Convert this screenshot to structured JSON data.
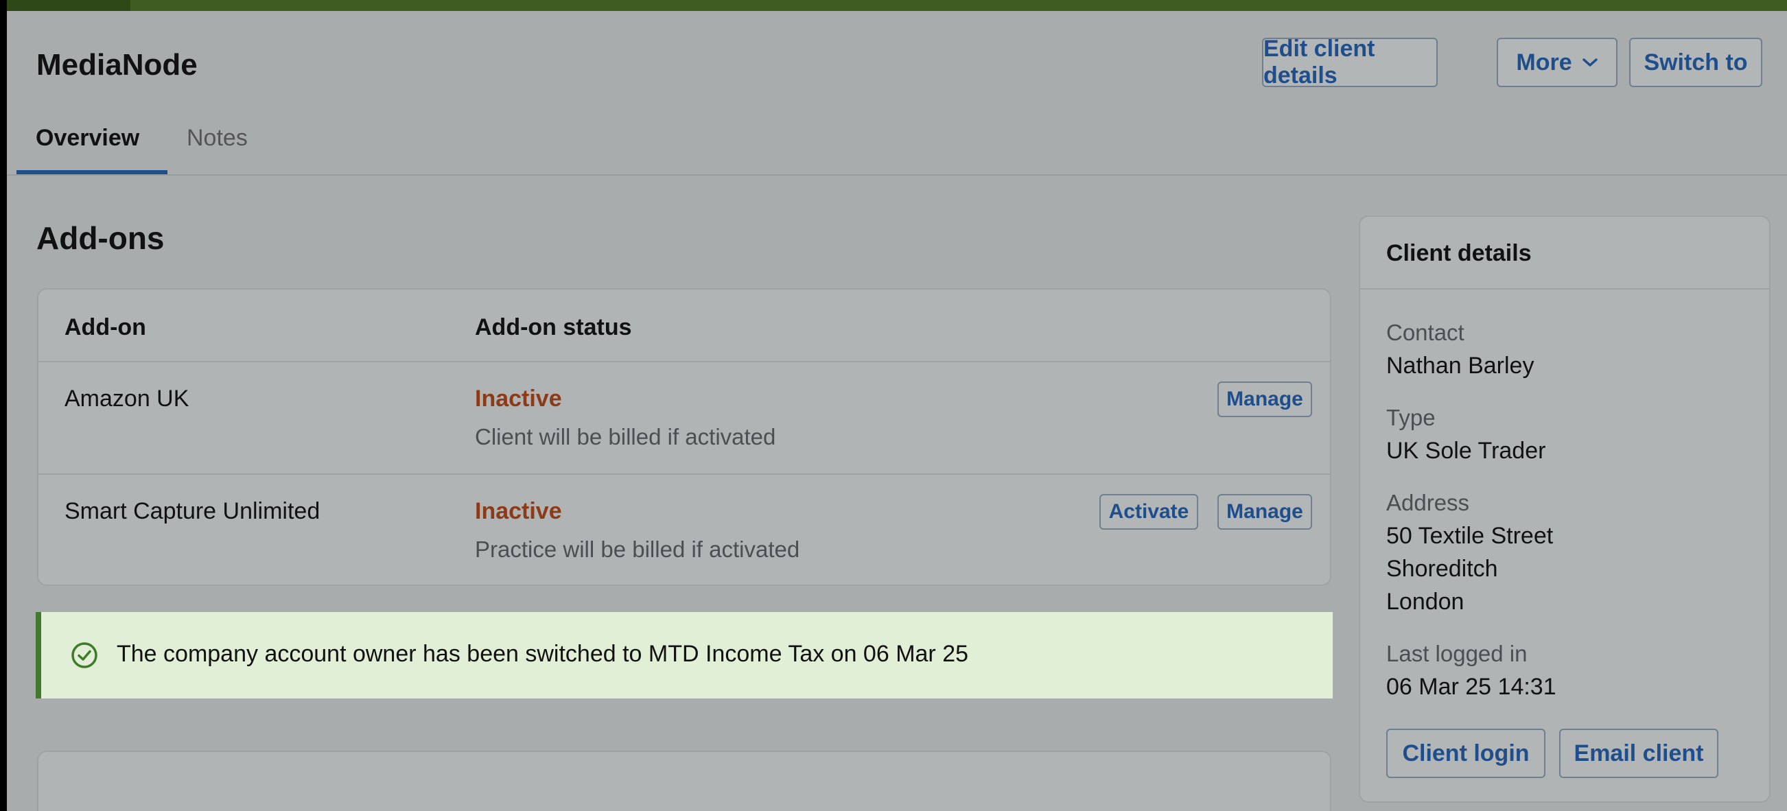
{
  "header": {
    "title": "MediaNode",
    "edit_label": "Edit client details",
    "more_label": "More",
    "switch_label": "Switch to"
  },
  "tabs": [
    {
      "label": "Overview",
      "active": true
    },
    {
      "label": "Notes",
      "active": false
    }
  ],
  "addons": {
    "section_title": "Add-ons",
    "columns": [
      "Add-on",
      "Add-on status"
    ],
    "rows": [
      {
        "name": "Amazon UK",
        "status": "Inactive",
        "note": "Client will be billed if activated",
        "actions": [
          "Manage"
        ]
      },
      {
        "name": "Smart Capture Unlimited",
        "status": "Inactive",
        "note": "Practice will be billed if activated",
        "actions": [
          "Activate",
          "Manage"
        ]
      }
    ]
  },
  "banner": {
    "message": "The company account owner has been switched to MTD Income Tax on 06 Mar 25"
  },
  "client_details": {
    "title": "Client details",
    "contact_label": "Contact",
    "contact_value": "Nathan Barley",
    "type_label": "Type",
    "type_value": "UK Sole Trader",
    "address_label": "Address",
    "address_lines": [
      "50 Textile Street",
      "Shoreditch",
      "London"
    ],
    "last_login_label": "Last logged in",
    "last_login_value": "06 Mar 25 14:31",
    "login_button": "Client login",
    "email_button": "Email client"
  },
  "colors": {
    "accent": "#1f4e8c",
    "inactive": "#8c3a17",
    "success": "#3f7a2d",
    "topbar": "#3f5d22"
  }
}
